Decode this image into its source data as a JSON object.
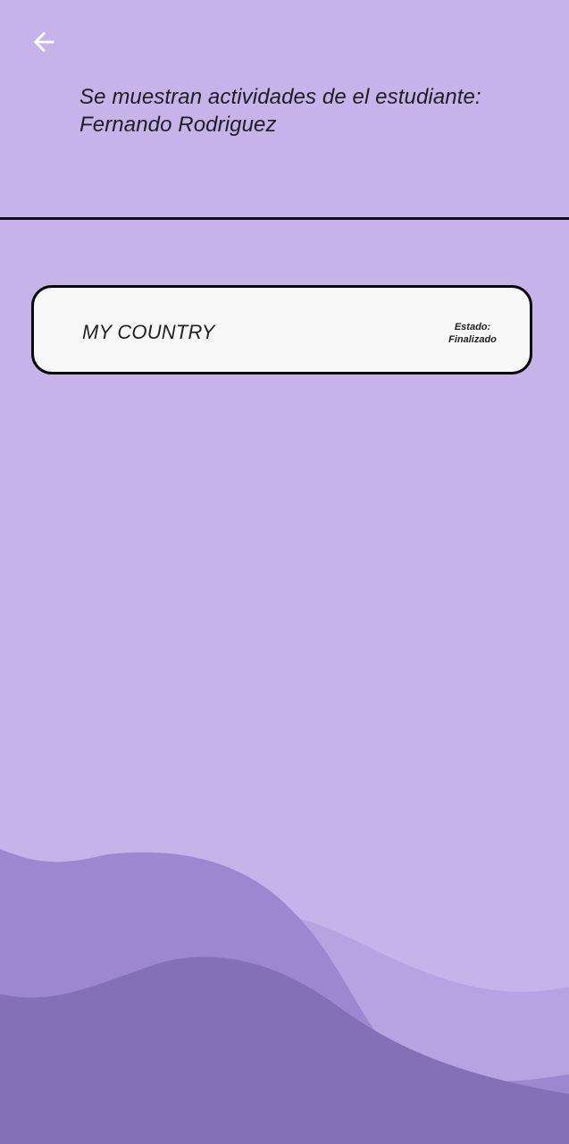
{
  "header": {
    "back_icon": "arrow-left-icon",
    "title_line_1": "Se muestran actividades de el estudiante:",
    "title_line_2": "Fernando Rodriguez"
  },
  "activities": [
    {
      "title": "MY COUNTRY",
      "status_label": "Estado:",
      "status_value": "Finalizado"
    }
  ],
  "colors": {
    "background": "#c5b3e9",
    "card_background": "#f8f8f8",
    "card_border": "#09070d",
    "wave_light": "#b6a4e2",
    "wave_mid": "#9c88d0",
    "wave_dark": "#8371b8",
    "icon_color": "#ffffff"
  }
}
